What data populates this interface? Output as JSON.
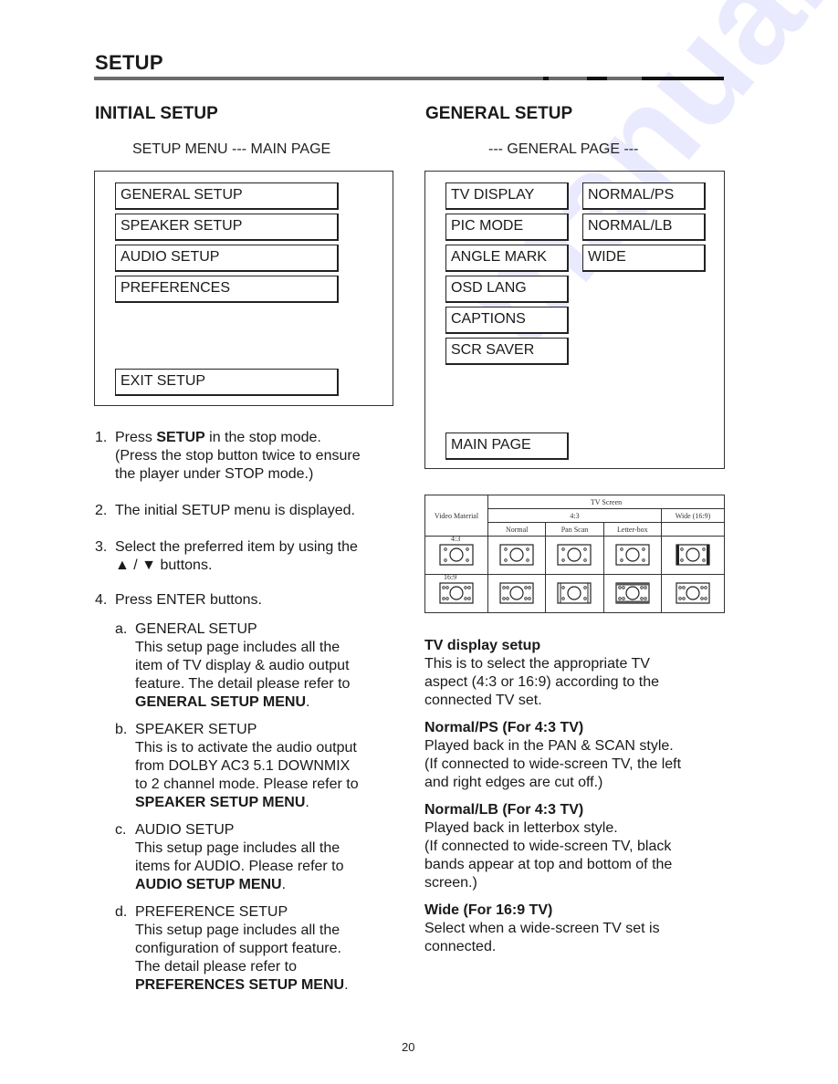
{
  "header": {
    "title": "SETUP"
  },
  "initial_setup": {
    "heading": "INITIAL SETUP",
    "caption": "SETUP MENU --- MAIN PAGE",
    "menu_items": [
      "GENERAL SETUP",
      "SPEAKER SETUP",
      "AUDIO SETUP",
      "PREFERENCES"
    ],
    "exit_label": "EXIT SETUP",
    "steps": [
      {
        "num": "1.",
        "lines": [
          "Press <b>SETUP</b> in the stop mode.",
          "(Press the stop button twice to ensure",
          "the player under STOP mode.)"
        ]
      },
      {
        "num": "2.",
        "lines": [
          "The initial SETUP menu is displayed."
        ]
      },
      {
        "num": "3.",
        "lines": [
          "Select the preferred item by using the",
          "▲ / ▼ buttons."
        ]
      },
      {
        "num": "4.",
        "lines": [
          "Press ENTER buttons."
        ]
      }
    ],
    "substeps": [
      {
        "letter": "a.",
        "lines": [
          "GENERAL SETUP",
          "This setup page includes all the",
          "item of TV display & audio output",
          "feature.  The detail please refer to",
          "<b>GENERAL SETUP MENU</b>."
        ]
      },
      {
        "letter": "b.",
        "lines": [
          "SPEAKER SETUP",
          "This is to activate the audio output",
          "from DOLBY AC3 5.1 DOWNMIX",
          "to 2 channel mode.  Please refer to",
          "<b>SPEAKER SETUP MENU</b>."
        ]
      },
      {
        "letter": "c.",
        "lines": [
          "AUDIO SETUP",
          "This setup page includes all the",
          "items for AUDIO.  Please refer to",
          "<b>AUDIO SETUP MENU</b>."
        ]
      },
      {
        "letter": "d.",
        "lines": [
          "PREFERENCE SETUP",
          "This setup page includes all the",
          "configuration of support feature.",
          "The detail please refer to",
          "<b>PREFERENCES SETUP MENU</b>."
        ]
      }
    ]
  },
  "general_setup": {
    "heading": "GENERAL SETUP",
    "caption": "--- GENERAL PAGE ---",
    "menu_items": [
      "TV DISPLAY",
      "PIC MODE",
      "ANGLE MARK",
      "OSD LANG",
      "CAPTIONS",
      "SCR SAVER"
    ],
    "options": [
      "NORMAL/PS",
      "NORMAL/LB",
      "WIDE"
    ],
    "main_page_label": "MAIN PAGE",
    "tv_table": {
      "video_material_label": "Video Material",
      "tv_screen_label": "TV Screen",
      "ratio_43_label": "4:3",
      "wide_label": "Wide (16:9)",
      "modes": [
        "Normal",
        "Pan Scan",
        "Letter-box"
      ],
      "row_labels": [
        "4:3",
        "16:9"
      ]
    },
    "descriptions": [
      {
        "title": "TV display setup",
        "lines": [
          "This is to select the appropriate TV",
          "aspect (4:3 or 16:9) according to the",
          "connected TV set."
        ]
      },
      {
        "title": "Normal/PS (For 4:3 TV)",
        "lines": [
          "Played back in the PAN & SCAN style.",
          "(If connected to wide-screen TV, the left",
          "and right edges are cut off.)"
        ]
      },
      {
        "title": "Normal/LB (For 4:3 TV)",
        "lines": [
          "Played back in letterbox style.",
          "(If connected to wide-screen TV, black",
          "bands appear at top and bottom of the",
          "screen.)"
        ]
      },
      {
        "title": "Wide (For 16:9 TV)",
        "lines": [
          "Select when a wide-screen TV set is",
          "connected."
        ]
      }
    ]
  },
  "footer": {
    "page_number": "20"
  },
  "watermark": {
    "text": "manualslib.com"
  }
}
